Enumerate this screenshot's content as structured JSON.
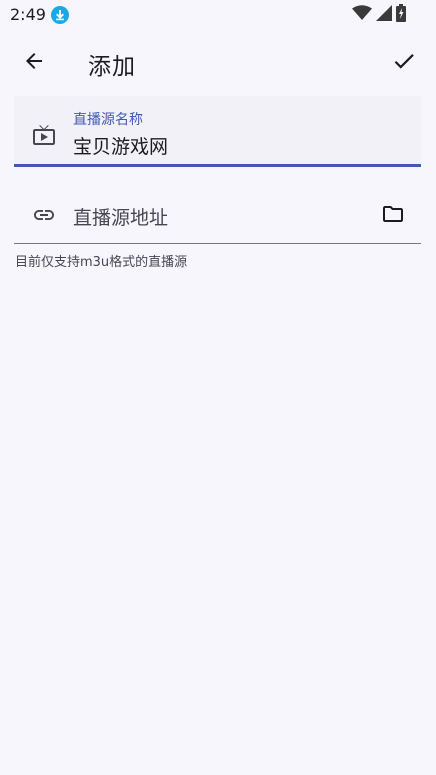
{
  "status_bar": {
    "time": "2:49",
    "icons": [
      "download-icon",
      "wifi-icon",
      "signal-icon",
      "battery-icon"
    ]
  },
  "app_bar": {
    "title": "添加",
    "back_icon": "arrow-back-icon",
    "confirm_icon": "check-icon"
  },
  "form": {
    "name_field": {
      "label": "直播源名称",
      "value": "宝贝游戏网",
      "icon": "tv-icon"
    },
    "url_field": {
      "placeholder": "直播源地址",
      "value": "",
      "icon": "link-icon",
      "trailing_icon": "folder-icon",
      "helper": "目前仅支持m3u格式的直播源"
    }
  },
  "colors": {
    "background": "#f8f6fd",
    "accent": "#3f5ab5",
    "field_fill": "#f3f1f8"
  }
}
